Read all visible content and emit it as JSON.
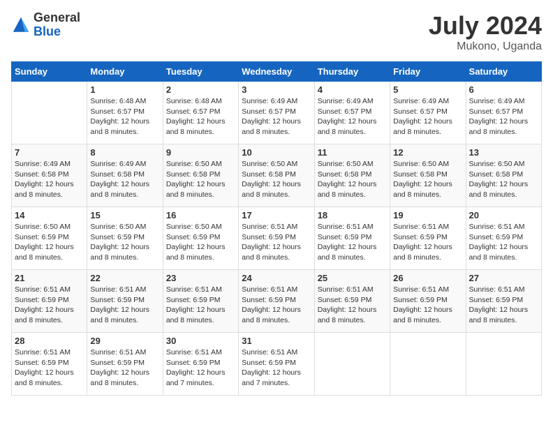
{
  "header": {
    "logo_general": "General",
    "logo_blue": "Blue",
    "month_year": "July 2024",
    "location": "Mukono, Uganda"
  },
  "days_of_week": [
    "Sunday",
    "Monday",
    "Tuesday",
    "Wednesday",
    "Thursday",
    "Friday",
    "Saturday"
  ],
  "weeks": [
    [
      {
        "day": "",
        "sunrise": "",
        "sunset": "",
        "daylight": ""
      },
      {
        "day": "1",
        "sunrise": "Sunrise: 6:48 AM",
        "sunset": "Sunset: 6:57 PM",
        "daylight": "Daylight: 12 hours and 8 minutes."
      },
      {
        "day": "2",
        "sunrise": "Sunrise: 6:48 AM",
        "sunset": "Sunset: 6:57 PM",
        "daylight": "Daylight: 12 hours and 8 minutes."
      },
      {
        "day": "3",
        "sunrise": "Sunrise: 6:49 AM",
        "sunset": "Sunset: 6:57 PM",
        "daylight": "Daylight: 12 hours and 8 minutes."
      },
      {
        "day": "4",
        "sunrise": "Sunrise: 6:49 AM",
        "sunset": "Sunset: 6:57 PM",
        "daylight": "Daylight: 12 hours and 8 minutes."
      },
      {
        "day": "5",
        "sunrise": "Sunrise: 6:49 AM",
        "sunset": "Sunset: 6:57 PM",
        "daylight": "Daylight: 12 hours and 8 minutes."
      },
      {
        "day": "6",
        "sunrise": "Sunrise: 6:49 AM",
        "sunset": "Sunset: 6:57 PM",
        "daylight": "Daylight: 12 hours and 8 minutes."
      }
    ],
    [
      {
        "day": "7",
        "sunrise": "Sunrise: 6:49 AM",
        "sunset": "Sunset: 6:58 PM",
        "daylight": "Daylight: 12 hours and 8 minutes."
      },
      {
        "day": "8",
        "sunrise": "Sunrise: 6:49 AM",
        "sunset": "Sunset: 6:58 PM",
        "daylight": "Daylight: 12 hours and 8 minutes."
      },
      {
        "day": "9",
        "sunrise": "Sunrise: 6:50 AM",
        "sunset": "Sunset: 6:58 PM",
        "daylight": "Daylight: 12 hours and 8 minutes."
      },
      {
        "day": "10",
        "sunrise": "Sunrise: 6:50 AM",
        "sunset": "Sunset: 6:58 PM",
        "daylight": "Daylight: 12 hours and 8 minutes."
      },
      {
        "day": "11",
        "sunrise": "Sunrise: 6:50 AM",
        "sunset": "Sunset: 6:58 PM",
        "daylight": "Daylight: 12 hours and 8 minutes."
      },
      {
        "day": "12",
        "sunrise": "Sunrise: 6:50 AM",
        "sunset": "Sunset: 6:58 PM",
        "daylight": "Daylight: 12 hours and 8 minutes."
      },
      {
        "day": "13",
        "sunrise": "Sunrise: 6:50 AM",
        "sunset": "Sunset: 6:58 PM",
        "daylight": "Daylight: 12 hours and 8 minutes."
      }
    ],
    [
      {
        "day": "14",
        "sunrise": "Sunrise: 6:50 AM",
        "sunset": "Sunset: 6:59 PM",
        "daylight": "Daylight: 12 hours and 8 minutes."
      },
      {
        "day": "15",
        "sunrise": "Sunrise: 6:50 AM",
        "sunset": "Sunset: 6:59 PM",
        "daylight": "Daylight: 12 hours and 8 minutes."
      },
      {
        "day": "16",
        "sunrise": "Sunrise: 6:50 AM",
        "sunset": "Sunset: 6:59 PM",
        "daylight": "Daylight: 12 hours and 8 minutes."
      },
      {
        "day": "17",
        "sunrise": "Sunrise: 6:51 AM",
        "sunset": "Sunset: 6:59 PM",
        "daylight": "Daylight: 12 hours and 8 minutes."
      },
      {
        "day": "18",
        "sunrise": "Sunrise: 6:51 AM",
        "sunset": "Sunset: 6:59 PM",
        "daylight": "Daylight: 12 hours and 8 minutes."
      },
      {
        "day": "19",
        "sunrise": "Sunrise: 6:51 AM",
        "sunset": "Sunset: 6:59 PM",
        "daylight": "Daylight: 12 hours and 8 minutes."
      },
      {
        "day": "20",
        "sunrise": "Sunrise: 6:51 AM",
        "sunset": "Sunset: 6:59 PM",
        "daylight": "Daylight: 12 hours and 8 minutes."
      }
    ],
    [
      {
        "day": "21",
        "sunrise": "Sunrise: 6:51 AM",
        "sunset": "Sunset: 6:59 PM",
        "daylight": "Daylight: 12 hours and 8 minutes."
      },
      {
        "day": "22",
        "sunrise": "Sunrise: 6:51 AM",
        "sunset": "Sunset: 6:59 PM",
        "daylight": "Daylight: 12 hours and 8 minutes."
      },
      {
        "day": "23",
        "sunrise": "Sunrise: 6:51 AM",
        "sunset": "Sunset: 6:59 PM",
        "daylight": "Daylight: 12 hours and 8 minutes."
      },
      {
        "day": "24",
        "sunrise": "Sunrise: 6:51 AM",
        "sunset": "Sunset: 6:59 PM",
        "daylight": "Daylight: 12 hours and 8 minutes."
      },
      {
        "day": "25",
        "sunrise": "Sunrise: 6:51 AM",
        "sunset": "Sunset: 6:59 PM",
        "daylight": "Daylight: 12 hours and 8 minutes."
      },
      {
        "day": "26",
        "sunrise": "Sunrise: 6:51 AM",
        "sunset": "Sunset: 6:59 PM",
        "daylight": "Daylight: 12 hours and 8 minutes."
      },
      {
        "day": "27",
        "sunrise": "Sunrise: 6:51 AM",
        "sunset": "Sunset: 6:59 PM",
        "daylight": "Daylight: 12 hours and 8 minutes."
      }
    ],
    [
      {
        "day": "28",
        "sunrise": "Sunrise: 6:51 AM",
        "sunset": "Sunset: 6:59 PM",
        "daylight": "Daylight: 12 hours and 8 minutes."
      },
      {
        "day": "29",
        "sunrise": "Sunrise: 6:51 AM",
        "sunset": "Sunset: 6:59 PM",
        "daylight": "Daylight: 12 hours and 8 minutes."
      },
      {
        "day": "30",
        "sunrise": "Sunrise: 6:51 AM",
        "sunset": "Sunset: 6:59 PM",
        "daylight": "Daylight: 12 hours and 7 minutes."
      },
      {
        "day": "31",
        "sunrise": "Sunrise: 6:51 AM",
        "sunset": "Sunset: 6:59 PM",
        "daylight": "Daylight: 12 hours and 7 minutes."
      },
      {
        "day": "",
        "sunrise": "",
        "sunset": "",
        "daylight": ""
      },
      {
        "day": "",
        "sunrise": "",
        "sunset": "",
        "daylight": ""
      },
      {
        "day": "",
        "sunrise": "",
        "sunset": "",
        "daylight": ""
      }
    ]
  ]
}
